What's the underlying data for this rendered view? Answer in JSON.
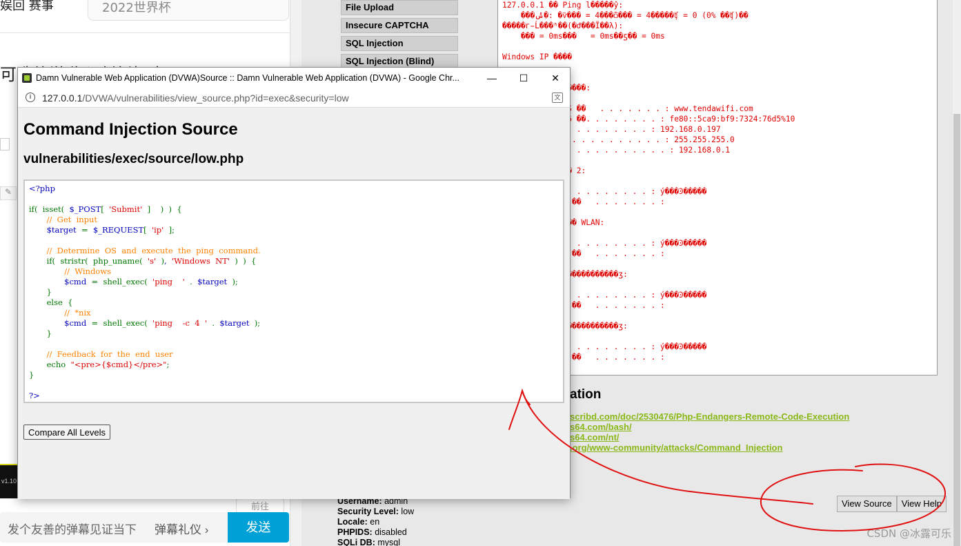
{
  "left_site": {
    "tab_text": "娱回 赛事",
    "search_placeholder": "2022世界杯",
    "headline": "可造旅游收入创新探索",
    "player_version": "v1.10",
    "goto_label": "前往",
    "danmaku_placeholder": "发个友善的弹幕见证当下",
    "danmaku_rules": "弹幕礼仪 ›",
    "send_label": "发送"
  },
  "dvwa": {
    "menu_items": [
      "File Upload",
      "Insecure CAPTCHA",
      "SQL Injection",
      "SQL Injection (Blind)"
    ],
    "ping_output": [
      "127.0.0.1 �� Ping l�����ŷ:",
      "    ���ݰ�: �ѷ��� = 4���ѽ��� = 4�����ʧ = 0 (0% ��ʧ)��",
      "�����г̵Ĺ���ʱ��(�Ժ���Ϊ��λ):",
      "    ��� = 0ms���   = 0ms��ƽ�� = 0ms",
      "",
      "Windows IP ����",
      "",
      "",
      "              ����:",
      "",
      "       ���� DNS ��   . . . . . . . : www.tendawifi.com",
      "       ��� IPv6 ��. . . . . . . . : fe80::5ca9:bf9:7324:76d5%10",
      "          . . . . . . . . . . . : 192.168.0.197",
      "       ��  . . . . . . . . . . . . : 255.255.255.0",
      "          . . . . . . . . . . . . . : 192.168.0.1",
      "",
      "       ��� ���� 2:",
      "",
      "          . . . . . . . . . . . : ý���Ͽ�����",
      "       ��� DNS ��   . . . . . . . :",
      "",
      "       ��������� WLAN:",
      "",
      "          . . . . . . . . . . . : ý���Ͽ�����",
      "       ��� DNS ��   . . . . . . . :",
      "",
      "       ������ �����������ӡ:",
      "",
      "          . . . . . . . . . . . : ý���Ͽ�����",
      "       ��� DNS ��   . . . . . . . :",
      "",
      "       ������ �����������ӡ:",
      "",
      "          . . . . . . . . . . . : ý���Ͽ�����",
      "       ��� DNS ��   . . . . . . . :"
    ],
    "more_info_title": "ation",
    "more_links": [
      "scribd.com/doc/2530476/Php-Endangers-Remote-Code-Execution",
      "s64.com/bash/",
      "s64.com/nt/",
      ".org/www-community/attacks/Command_Injection"
    ],
    "footer": {
      "username_label": "Username:",
      "username": "admin",
      "security_label": "Security Level:",
      "security": "low",
      "locale_label": "Locale:",
      "locale": "en",
      "phpids_label": "PHPIDS:",
      "phpids": "disabled",
      "sqlidb_label": "SQLi DB:",
      "sqlidb": "mysql"
    },
    "view_source_label": "View Source",
    "view_help_label": "View Help"
  },
  "popup": {
    "window_title": "Damn Vulnerable Web Application (DVWA)Source :: Damn Vulnerable Web Application (DVWA) - Google Chr...",
    "url_host": "127.0.0.1",
    "url_path": "/DVWA/vulnerabilities/view_source.php?id=exec&security=low",
    "heading": "Command Injection Source",
    "file_path": "vulnerabilities/exec/source/low.php",
    "compare_label": "Compare All Levels",
    "code_lines": [
      "<?php",
      "",
      "if(  isset(  $_POST[  'Submit'  ]    )  )  {",
      "       //  Get  input",
      "       $target  =  $_REQUEST[  'ip'  ];",
      "",
      "       //  Determine  OS  and  execute  the  ping  command.",
      "       if(  stristr(  php_uname(  's'  ),  'Windows  NT'  )  )  {",
      "              //  Windows",
      "              $cmd  =  shell_exec(  'ping    '  .  $target  );",
      "       }",
      "       else  {",
      "              //  *nix",
      "              $cmd  =  shell_exec(  'ping    -c  4  '  .  $target  );",
      "       }",
      "",
      "       //  Feedback  for  the  end  user",
      "       echo  \"<pre>{$cmd}</pre>\";",
      "}",
      "",
      "?>"
    ]
  },
  "watermark": "CSDN @冰露可乐",
  "colors": {
    "ping_text": "#e00000",
    "link_green": "#8ab818",
    "annotation_red": "#e01010",
    "send_blue": "#00a1d6"
  }
}
